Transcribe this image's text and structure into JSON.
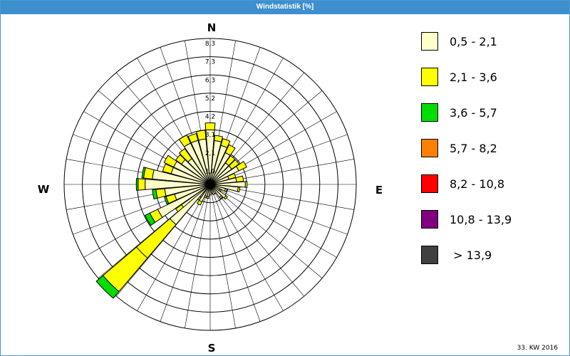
{
  "window": {
    "title": "Windstatistik [%]"
  },
  "footnote": "33. KW 2016",
  "chart_data": {
    "type": "windrose",
    "title": "Windstatistik [%]",
    "unit": "%",
    "compass": {
      "north": "N",
      "east": "E",
      "south": "S",
      "west": "W"
    },
    "radial_ticks": [
      "1,0",
      "2,1",
      "3,1",
      "4,2",
      "5,2",
      "6,3",
      "7,3",
      "8,3"
    ],
    "radial_max": 8.3,
    "grid": true,
    "legend_position": "right",
    "speed_classes": [
      {
        "label": "0,5 - 2,1",
        "color": "#ffffcc"
      },
      {
        "label": "2,1 - 3,6",
        "color": "#ffff00"
      },
      {
        "label": "3,6 - 5,7",
        "color": "#00dd00"
      },
      {
        "label": "5,7 - 8,2",
        "color": "#ff8000"
      },
      {
        "label": "8,2 - 10,8",
        "color": "#ff0000"
      },
      {
        "label": "10,8 - 13,9",
        "color": "#800080"
      },
      {
        "label": " > 13,9",
        "color": "#404040"
      }
    ],
    "directions_deg": [
      0,
      10,
      20,
      30,
      40,
      50,
      60,
      70,
      80,
      90,
      100,
      110,
      120,
      130,
      140,
      150,
      160,
      170,
      180,
      190,
      200,
      210,
      220,
      230,
      240,
      250,
      260,
      270,
      280,
      290,
      300,
      310,
      320,
      330,
      340,
      350
    ],
    "frequencies": [
      [
        3.1,
        0.4,
        0,
        0,
        0,
        0,
        0
      ],
      [
        2.5,
        0.3,
        0,
        0,
        0,
        0,
        0
      ],
      [
        2.3,
        0.4,
        0,
        0,
        0,
        0,
        0
      ],
      [
        2.0,
        0.5,
        0,
        0,
        0,
        0,
        0
      ],
      [
        1.5,
        0.5,
        0,
        0,
        0,
        0,
        0
      ],
      [
        1.5,
        0.5,
        0,
        0,
        0,
        0,
        0
      ],
      [
        1.8,
        0.5,
        0,
        0,
        0,
        0,
        0
      ],
      [
        1.1,
        0.4,
        0,
        0,
        0,
        0,
        0
      ],
      [
        1.5,
        0.4,
        0,
        0,
        0,
        0,
        0
      ],
      [
        2.0,
        0.1,
        0,
        0,
        0,
        0,
        0
      ],
      [
        1.6,
        0.1,
        0,
        0,
        0,
        0,
        0
      ],
      [
        0.9,
        0.1,
        0,
        0,
        0,
        0,
        0
      ],
      [
        0.6,
        0.1,
        0,
        0,
        0,
        0,
        0
      ],
      [
        1.1,
        0.1,
        0,
        0,
        0,
        0,
        0
      ],
      [
        0.9,
        0.1,
        0,
        0,
        0,
        0,
        0
      ],
      [
        0.6,
        0,
        0,
        0,
        0,
        0,
        0
      ],
      [
        0.6,
        0,
        0,
        0,
        0,
        0,
        0
      ],
      [
        0.5,
        0,
        0,
        0,
        0,
        0,
        0
      ],
      [
        0.6,
        0,
        0,
        0,
        0,
        0,
        0
      ],
      [
        0.7,
        0.1,
        0,
        0,
        0,
        0,
        0
      ],
      [
        0.7,
        0.1,
        0,
        0,
        0,
        0,
        0
      ],
      [
        1.1,
        0.2,
        0,
        0,
        0,
        0,
        0
      ],
      [
        0.9,
        0.2,
        0,
        0,
        0,
        0,
        0
      ],
      [
        2.0,
        0.4,
        0,
        0,
        0,
        0,
        0
      ],
      [
        3.3,
        0.5,
        0.3,
        0,
        0,
        0,
        0
      ],
      [
        2.1,
        0.5,
        0.1,
        0,
        0,
        0,
        0
      ],
      [
        2.6,
        0.5,
        0.2,
        0,
        0,
        0,
        0
      ],
      [
        3.7,
        0.4,
        0.1,
        0,
        0,
        0,
        0
      ],
      [
        3.3,
        0.5,
        0.1,
        0,
        0,
        0,
        0
      ],
      [
        2.3,
        0.5,
        0,
        0,
        0,
        0,
        0
      ],
      [
        2.3,
        0.6,
        0,
        0,
        0,
        0,
        0
      ],
      [
        2.0,
        0.4,
        0,
        0,
        0,
        0,
        0
      ],
      [
        1.8,
        0.7,
        0,
        0,
        0,
        0,
        0
      ],
      [
        2.6,
        0.5,
        0,
        0,
        0,
        0,
        0
      ],
      [
        2.6,
        0.4,
        0,
        0,
        0,
        0,
        0
      ],
      [
        2.6,
        0.5,
        0,
        0,
        0,
        0,
        0
      ]
    ],
    "extra_segments": [
      {
        "direction_deg": 225,
        "values": [
          3.0,
          3.5,
          0.5,
          0,
          0,
          0,
          0
        ]
      },
      {
        "direction_deg": 225,
        "values": [
          0,
          2.5,
          0.5,
          0,
          0,
          0,
          0
        ],
        "offset": 5.5
      }
    ]
  }
}
